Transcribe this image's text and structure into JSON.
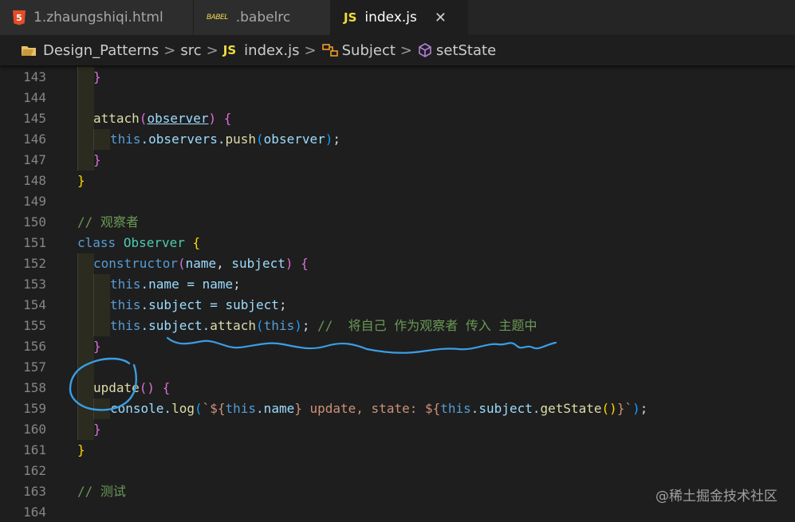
{
  "tabs": [
    {
      "label": "1.zhaungshiqi.html",
      "icon": "html5-icon",
      "active": false
    },
    {
      "label": ".babelrc",
      "icon": "babel-icon",
      "icon_text": "BABEL",
      "active": false
    },
    {
      "label": "index.js",
      "icon": "js-icon",
      "icon_text": "JS",
      "active": true,
      "close": "✕"
    }
  ],
  "breadcrumb": {
    "items": [
      "Design_Patterns",
      "src",
      "index.js",
      "Subject",
      "setState"
    ],
    "js_icon_text": "JS",
    "separator": ">"
  },
  "editor": {
    "line_numbers": [
      "143",
      "144",
      "145",
      "146",
      "147",
      "148",
      "149",
      "150",
      "151",
      "152",
      "153",
      "154",
      "155",
      "156",
      "157",
      "158",
      "159",
      "160",
      "161",
      "162",
      "163",
      "164"
    ],
    "tokens": {
      "close_brace": "}",
      "attach": "attach",
      "observer": "observer",
      "this": "this",
      "observers_push": ".observers.",
      "push": "push",
      "comment_observer": "// 观察者",
      "class": "class",
      "Observer": "Observer",
      "constructor": "constructor",
      "name": "name",
      "subject": "subject",
      "dot_name_eq": ".name = ",
      "dot_subject_eq": ".subject = ",
      "dot_subject_dot": ".subject.",
      "comment_attach": "//  将自己 作为观察者 传入 主题中",
      "update": "update",
      "console_log": "console.",
      "log": "log",
      "tpl_open": "`${",
      "tpl_name": ".name",
      "tpl_mid": " update, state: ${",
      "tpl_subject": ".subject.",
      "getState": "getState",
      "tpl_close": "`",
      "comment_test": "// 测试"
    }
  },
  "watermark": "@稀土掘金技术社区",
  "colors": {
    "annotation": "#3a9ee4"
  }
}
